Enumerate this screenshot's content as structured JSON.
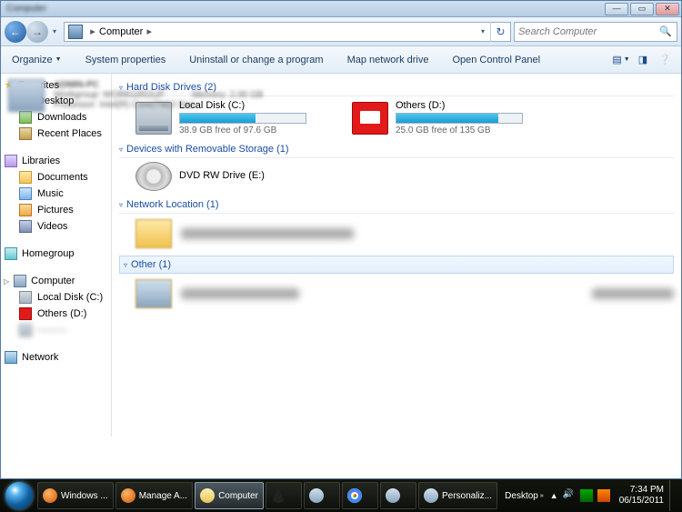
{
  "titlebar": {
    "caption": "Computer"
  },
  "nav": {
    "location_label": "Computer",
    "chevron": "▸",
    "refresh": "↻",
    "dropdown": "▾",
    "search_placeholder": "Search Computer"
  },
  "toolbar": {
    "organize": "Organize",
    "system_properties": "System properties",
    "uninstall": "Uninstall or change a program",
    "map_drive": "Map network drive",
    "control_panel": "Open Control Panel"
  },
  "sidebar": {
    "favorites": "Favorites",
    "desktop": "Desktop",
    "downloads": "Downloads",
    "recent": "Recent Places",
    "libraries": "Libraries",
    "documents": "Documents",
    "music": "Music",
    "pictures": "Pictures",
    "videos": "Videos",
    "homegroup": "Homegroup",
    "computer": "Computer",
    "local_c": "Local Disk (C:)",
    "others_d": "Others (D:)",
    "network": "Network"
  },
  "content": {
    "hdd_group": "Hard Disk Drives (2)",
    "removable_group": "Devices with Removable Storage (1)",
    "network_group": "Network Location (1)",
    "other_group": "Other (1)",
    "drive_c": {
      "name": "Local Disk (C:)",
      "free": "38.9 GB free of 97.6 GB",
      "fill_pct": 60
    },
    "drive_d": {
      "name": "Others (D:)",
      "free": "25.0 GB free of 135 GB",
      "fill_pct": 81
    },
    "dvd": {
      "name": "DVD RW Drive (E:)"
    }
  },
  "details": {
    "name": "ADMIN-PC",
    "workgroup_label": "Workgroup:",
    "workgroup": "WORKGROUP",
    "memory_label": "Memory:",
    "memory": "2.00 GB",
    "proc_label": "Processor:",
    "proc": "Intel(R) Core(TM)2 Duo"
  },
  "taskbar": {
    "items": [
      {
        "label": "Windows ...",
        "icon": "ff"
      },
      {
        "label": "Manage A...",
        "icon": "ff"
      },
      {
        "label": "Computer",
        "icon": "ex",
        "selected": true
      },
      {
        "label": "",
        "icon": "wm"
      },
      {
        "label": "",
        "icon": "blank"
      },
      {
        "label": "",
        "icon": "ch"
      },
      {
        "label": "",
        "icon": "blank"
      },
      {
        "label": "Personaliz...",
        "icon": "blank"
      }
    ],
    "desktop_toolbar": "Desktop",
    "time": "7:34 PM",
    "date": "06/15/2011"
  }
}
